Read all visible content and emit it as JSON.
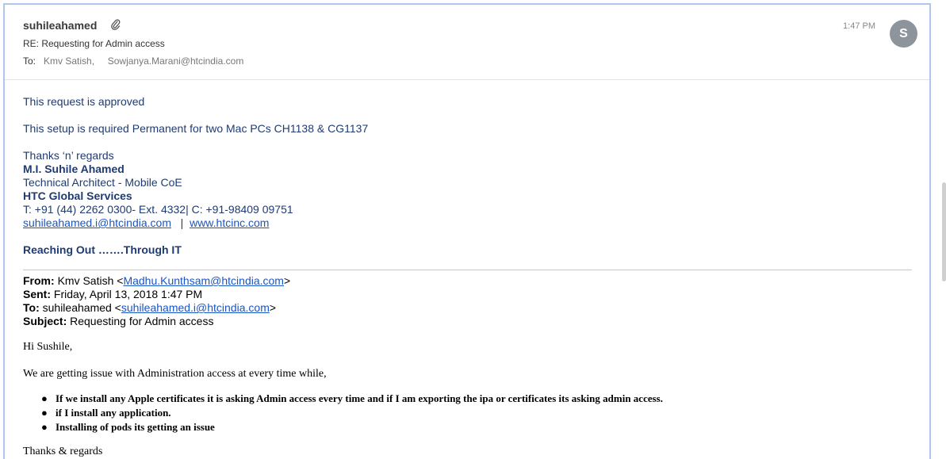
{
  "header": {
    "sender": "suhileahamed",
    "subject": "RE: Requesting for Admin access",
    "to_label": "To:",
    "recipients": [
      "Kmv Satish,",
      "Sowjanya.Marani@htcindia.com"
    ],
    "time": "1:47 PM",
    "avatar_initial": "S"
  },
  "body": {
    "line1": "This request is approved",
    "line2": "This setup is required Permanent for two Mac PCs CH1138 & CG1137",
    "signature": {
      "thanks": "Thanks ‘n’ regards",
      "name": "M.I. Suhile Ahamed",
      "title": "Technical Architect - Mobile CoE",
      "company": "HTC Global Services",
      "phone": "T: +91 (44) 2262 0300- Ext. 4332| C: +91-98409 09751",
      "email": "suhileahamed.i@htcindia.com",
      "separator": "|",
      "website": "www.htcinc.com",
      "tagline": "Reaching Out …….Through IT"
    }
  },
  "quoted": {
    "from_label": "From:",
    "from_name": "Kmv Satish <",
    "from_email": "Madhu.Kunthsam@htcindia.com",
    "from_end": ">",
    "sent_label": "Sent:",
    "sent_value": "Friday, April 13, 2018 1:47 PM",
    "to_label": "To:",
    "to_name": "suhileahamed <",
    "to_email": "suhileahamed.i@htcindia.com",
    "to_end": ">",
    "subject_label": "Subject:",
    "subject_value": "Requesting for Admin access",
    "greeting": "Hi Sushile,",
    "intro": "We are getting issue with Administration access at every time while,",
    "bullets": [
      "If we install any Apple certificates it is asking Admin access every time and if I am exporting the ipa or certificates its asking admin access.",
      "if I install any application.",
      "Installing of pods its getting an issue"
    ],
    "trailing": "Thanks & regards"
  },
  "colors": {
    "signature_blue": "#1f3b72",
    "link_blue": "#1a55c4",
    "frame_border": "#b1c6ec",
    "avatar_bg": "#8e949c"
  }
}
